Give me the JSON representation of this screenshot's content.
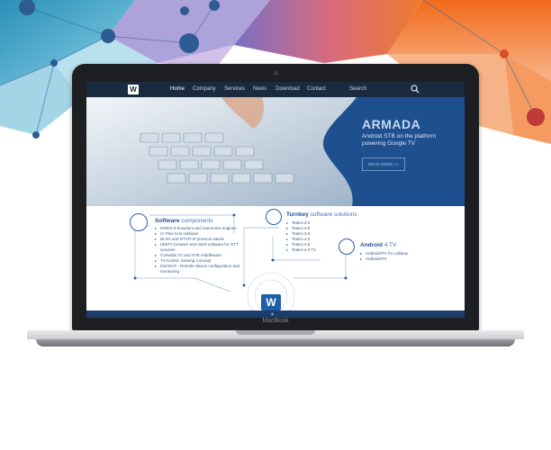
{
  "nav": {
    "logo": "W",
    "items": [
      "Home",
      "Company",
      "Services",
      "News",
      "Download",
      "Contact"
    ],
    "search_label": "Search"
  },
  "hero": {
    "title": "ARMADA",
    "subtitle": "Android STB on the platform powering Google TV",
    "button": "READ MORE >>"
  },
  "software": {
    "title_bold": "Software",
    "title_light": " components",
    "items": [
      "MHEG-5 browsers and interactive engines",
      "CI Plus host software",
      "DLNA and DTCP-IP protocol stacks",
      "HbbTV browser and client software for OTT services",
      "Comedia TV and STB middleware",
      "TV-Centric Gaming Concept",
      "INSIGHT - Remote device configuration and monitoring"
    ]
  },
  "turnkey": {
    "title_bold": "Turnkey",
    "title_light": " software solutions",
    "items": [
      "Teatro-2.0",
      "Teatro-3.0",
      "Teatro-3.5",
      "Teatro-4.0",
      "Teatro-4.5",
      "Teatro-4.0 TV"
    ]
  },
  "android": {
    "title_bold": "Android",
    "title_light": " 4 TV",
    "items": [
      "Android4TV for Lollipop",
      "Android4TV"
    ]
  },
  "center_logo": "W",
  "laptop_brand": "MacBook",
  "colors": {
    "nav": "#1a2a3f",
    "accent": "#1f4f94",
    "hero": "#1e4f8e"
  }
}
